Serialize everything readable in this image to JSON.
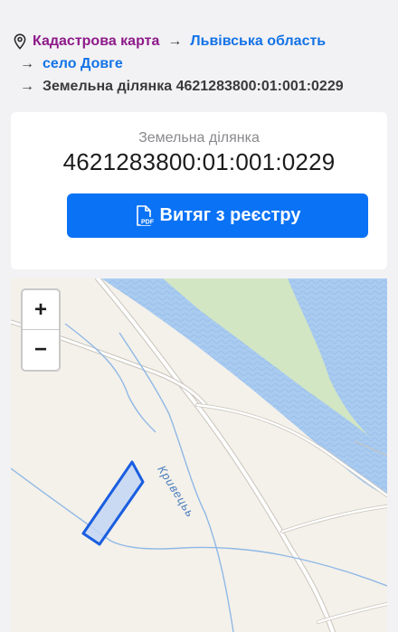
{
  "breadcrumb": {
    "root_label": "Кадастрова карта",
    "region_label": "Львівська область",
    "village_label": "село Довге",
    "current_label": "Земельна ділянка 4621283800:01:001:0229",
    "arrow": "→"
  },
  "card": {
    "subtitle": "Земельна ділянка",
    "cadastral_number": "4621283800:01:001:0229",
    "extract_button_label": "Витяг з реєстру",
    "pdf_badge": "PDF"
  },
  "map": {
    "zoom_in_label": "+",
    "zoom_out_label": "−",
    "river_label": "Кривецьь",
    "colors": {
      "water": "#a9cbf0",
      "forest": "#d3e6c3",
      "land": "#f4f1ea",
      "parcel_fill": "#c3d6f5",
      "parcel_stroke": "#1a5ee0",
      "stream": "#8fb8e6",
      "road": "#ffffff"
    }
  },
  "colors": {
    "accent": "#0a72f5",
    "link_blue": "#1473e6",
    "link_purple": "#8e1a8a"
  }
}
